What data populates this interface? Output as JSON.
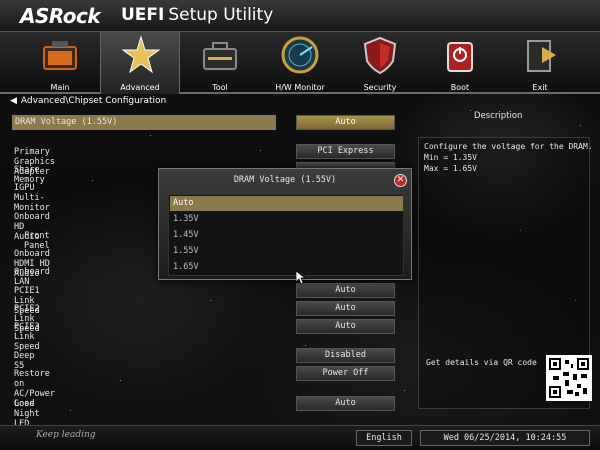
{
  "app": {
    "brand": "ASRock",
    "title_bold": "UEFI",
    "title_rest": "Setup Utility"
  },
  "menu": [
    {
      "label": "Main",
      "icon": "main-icon",
      "active": false
    },
    {
      "label": "Advanced",
      "icon": "advanced-icon",
      "active": true
    },
    {
      "label": "Tool",
      "icon": "tool-icon",
      "active": false
    },
    {
      "label": "H/W Monitor",
      "icon": "hw-monitor-icon",
      "active": false
    },
    {
      "label": "Security",
      "icon": "security-icon",
      "active": false
    },
    {
      "label": "Boot",
      "icon": "boot-icon",
      "active": false
    },
    {
      "label": "Exit",
      "icon": "exit-icon",
      "active": false
    }
  ],
  "breadcrumb": "Advanced\\Chipset Configuration",
  "settings": [
    {
      "label": "DRAM Voltage (1.55V)",
      "value": "Auto",
      "selected": true
    },
    {
      "label": "Primary Graphics Adapter",
      "value": "PCI Express"
    },
    {
      "label": "Share Memory",
      "value": ""
    },
    {
      "label": "IGPU Multi-Monitor",
      "value": ""
    },
    {
      "label": "Onboard HD Audio",
      "value": ""
    },
    {
      "label": "Front Panel",
      "value": ""
    },
    {
      "label": "Onboard HDMI HD Audio",
      "value": ""
    },
    {
      "label": "Onboard LAN",
      "value": ""
    },
    {
      "label": "PCIE1 Link Speed",
      "value": "Auto"
    },
    {
      "label": "PCIE2 Link Speed",
      "value": "Auto"
    },
    {
      "label": "PCIE3 Link Speed",
      "value": "Auto"
    },
    {
      "label": "Deep S5",
      "value": "Disabled"
    },
    {
      "label": "Restore on AC/Power Loss",
      "value": "Power Off"
    },
    {
      "label": "Good Night LED",
      "value": "Auto"
    }
  ],
  "description": {
    "title": "Description",
    "lines": [
      "Configure the voltage for the DRAM.",
      "Min = 1.35V",
      "Max = 1.65V"
    ],
    "qr_label": "Get details via QR code"
  },
  "dialog": {
    "title": "DRAM Voltage (1.55V)",
    "close_icon": "close-icon",
    "options": [
      "Auto",
      "1.35V",
      "1.45V",
      "1.55V",
      "1.65V"
    ],
    "selected_index": 0
  },
  "footer": {
    "tagline": "Keep leading",
    "language": "English",
    "datetime": "Wed 06/25/2014, 10:24:55"
  },
  "colors": {
    "highlight": "#8a7a4c",
    "value_selected": "#a8924c",
    "close_red": "#c0282a"
  }
}
